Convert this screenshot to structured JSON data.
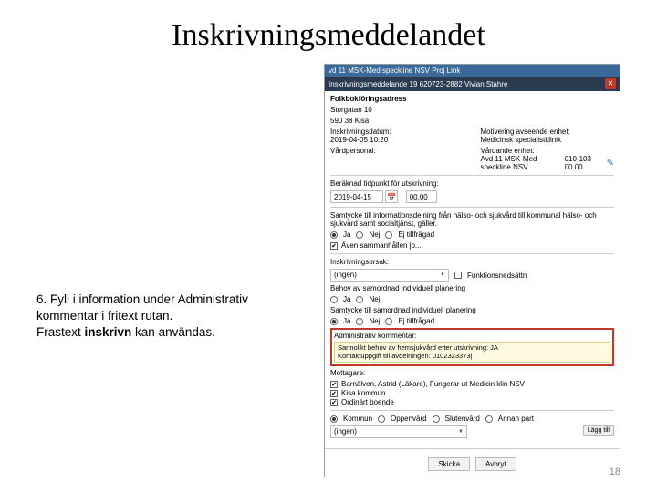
{
  "title": "Inskrivningsmeddelandet",
  "instruction": {
    "text1": "6. Fyll i information under Administrativ kommentar i fritext rutan.",
    "text2_a": "Frastext ",
    "text2_b": "inskrivn",
    "text2_c": " kan användas."
  },
  "app": {
    "titlebar": "vd 11 MSK-Med speckline NSV Proj Link",
    "header": "Inskrivningsmeddelande 19 620723-2882 Vivian Stahre",
    "addr_label": "Folkbokföringsadress",
    "addr_line1": "Storgatan 10",
    "addr_line2": "590 38 Kisa",
    "inskrivdatum_lbl": "Inskrivningsdatum:",
    "inskrivdatum_val": "2019-04-05 10:20",
    "motivering_lbl": "Motivering avseende enhet:",
    "motivering_val": "Medicinsk specialistklinik",
    "vardpersonal_lbl": "Vårdpersonal:",
    "vardande_enhet_lbl": "Vårdande enhet:",
    "vardande_enhet_val": "Avd 11 MSK-Med speckline NSV",
    "phone": "010-103 00 00",
    "beraknad_lbl": "Beräknad tidpunkt för utskrivning:",
    "date_val": "2019-04-15",
    "time_val": "00.00",
    "samtycke_lbl": "Samtycke till informationsdelning från hälso- och sjukvård till kommunal hälso- och sjukvård samt socialtjänst, gäller.",
    "radio_ja": "Ja",
    "radio_nej": "Nej",
    "radio_ej": "Ej tillfrågad",
    "aven_lbl": "Även sammanhållen jo...",
    "inskrivorsak_lbl": "Inskrivningsorsak:",
    "inskrivorsak_val": "(ingen)",
    "funkned_lbl": "Funktionsnedsättn",
    "behov_plan_lbl": "Behov av samordnad individuell planering",
    "samt_plan_lbl": "Samtycke till samordnad individuell planering",
    "admin_lbl": "Administrativ kommentar:",
    "comment_line1": "Sannolikt behov av hemsjukvård efter utskrivning: JA",
    "comment_line2": "Kontaktuppgift till avdelningen: 0102323373|",
    "mottagare_lbl": "Mottagare:",
    "recv1": "Barnälven, Astrid (Läkare), Fungerar ut Medicin klin NSV",
    "recv2": "Kisa kommun",
    "recv3": "Ordinärt boende",
    "scope_kommun": "Kommun",
    "scope_oppen": "Öppenvård",
    "scope_sluten": "Slutenvård",
    "scope_annan": "Annan part",
    "bottom_sel": "(ingen)",
    "lagg_till": "Lägg till",
    "btn_skicka": "Skicka",
    "btn_avbryt": "Avbryt"
  },
  "pagenum": "18"
}
